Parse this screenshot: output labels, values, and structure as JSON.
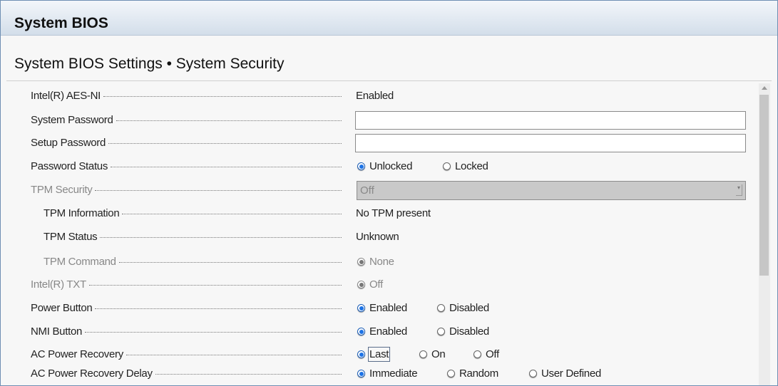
{
  "header": {
    "title": "System BIOS"
  },
  "page": {
    "subtitle": "System BIOS Settings • System Security"
  },
  "settings": [
    {
      "label": "Intel(R) AES-NI",
      "value": "Enabled"
    },
    {
      "label": "System Password",
      "value": ""
    },
    {
      "label": "Setup Password",
      "value": ""
    },
    {
      "label": "Password Status",
      "options": [
        "Unlocked",
        "Locked"
      ],
      "selected": "Unlocked"
    },
    {
      "label": "TPM Security",
      "value": "Off"
    },
    {
      "label": "TPM Information",
      "value": "No TPM present"
    },
    {
      "label": "TPM Status",
      "value": "Unknown"
    },
    {
      "label": "TPM Command",
      "options": [
        "None"
      ],
      "selected": "None"
    },
    {
      "label": "Intel(R) TXT",
      "options": [
        "Off"
      ],
      "selected": "Off"
    },
    {
      "label": "Power Button",
      "options": [
        "Enabled",
        "Disabled"
      ],
      "selected": "Enabled"
    },
    {
      "label": "NMI Button",
      "options": [
        "Enabled",
        "Disabled"
      ],
      "selected": "Enabled"
    },
    {
      "label": "AC Power Recovery",
      "options": [
        "Last",
        "On",
        "Off"
      ],
      "selected": "Last"
    },
    {
      "label": "AC Power Recovery Delay",
      "options": [
        "Immediate",
        "Random",
        "User Defined"
      ],
      "selected": "Immediate"
    }
  ]
}
